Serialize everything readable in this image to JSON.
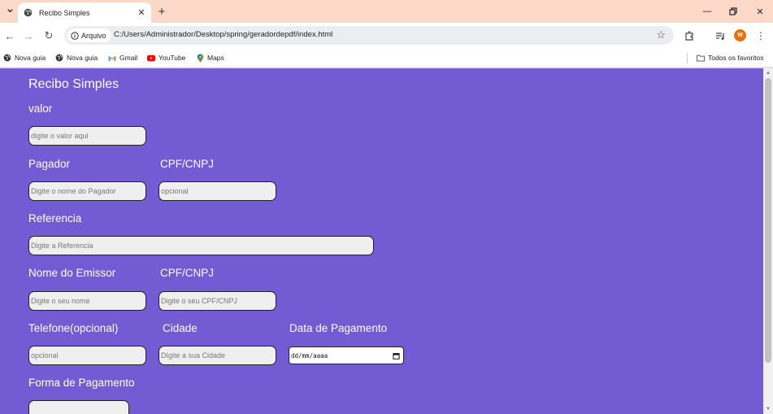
{
  "browser": {
    "tab": {
      "title": "Recibo Simples"
    },
    "address": {
      "chip_label": "Arquivo",
      "url": "C:/Users/Administrador/Desktop/spring/geradordepdf/index.html"
    },
    "profile_initial": "W",
    "bookmarks": [
      {
        "label": "Nova guia",
        "icon": "globe-icon"
      },
      {
        "label": "Nova guia",
        "icon": "globe-icon"
      },
      {
        "label": "Gmail",
        "icon": "gmail-icon"
      },
      {
        "label": "YouTube",
        "icon": "youtube-icon"
      },
      {
        "label": "Maps",
        "icon": "maps-icon"
      }
    ],
    "favorites_label": "Todos os favoritos"
  },
  "form": {
    "title": "Recibo Simples",
    "valor": {
      "label": "valor",
      "placeholder": "digite o valor aqui"
    },
    "pagador": {
      "label": "Pagador",
      "placeholder": "Digite o nome do Pagador"
    },
    "pagador_doc": {
      "label": "CPF/CNPJ",
      "placeholder": "opcional"
    },
    "referencia": {
      "label": "Referencia",
      "placeholder": "Digite a Referencia"
    },
    "emissor": {
      "label": "Nome do Emissor",
      "placeholder": "Digite o seu nome"
    },
    "emissor_doc": {
      "label": "CPF/CNPJ",
      "placeholder": "Digite o seu CPF/CNPJ"
    },
    "telefone": {
      "label": "Telefone(opcional)",
      "placeholder": "opcional"
    },
    "cidade": {
      "label": "Cidade",
      "placeholder": "DIgite a sua Cidade"
    },
    "data_pagamento": {
      "label": "Data de Pagamento",
      "value": "dd/mm/aaaa"
    },
    "forma_pagamento": {
      "label": "Forma de Pagamento",
      "value": ""
    }
  },
  "colors": {
    "page_bg": "#735bd3",
    "chrome_bg": "#fbd8c7"
  }
}
